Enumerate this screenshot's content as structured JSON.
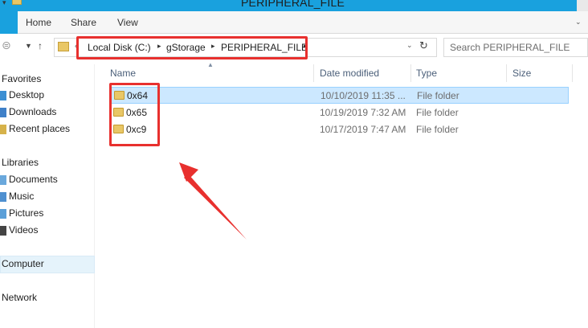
{
  "window": {
    "title": "PERIPHERAL_FILE"
  },
  "ribbon": {
    "tabs": [
      "Home",
      "Share",
      "View"
    ]
  },
  "address": {
    "breadcrumbs": [
      "Local Disk (C:)",
      "gStorage",
      "PERIPHERAL_FILE"
    ]
  },
  "search": {
    "placeholder": "Search PERIPHERAL_FILE"
  },
  "nav_pane": {
    "favorites_header": "Favorites",
    "favorites": [
      "Desktop",
      "Downloads",
      "Recent places"
    ],
    "libraries_header": "Libraries",
    "libraries": [
      "Documents",
      "Music",
      "Pictures",
      "Videos"
    ],
    "computer": "Computer",
    "network": "Network"
  },
  "columns": {
    "name": "Name",
    "date_modified": "Date modified",
    "type": "Type",
    "size": "Size"
  },
  "files": [
    {
      "name": "0x64",
      "date_modified": "10/10/2019 11:35 ...",
      "type": "File folder",
      "selected": true
    },
    {
      "name": "0x65",
      "date_modified": "10/19/2019 7:32 AM",
      "type": "File folder",
      "selected": false
    },
    {
      "name": "0xc9",
      "date_modified": "10/17/2019 7:47 AM",
      "type": "File folder",
      "selected": false
    }
  ],
  "colors": {
    "accent": "#19a1de",
    "annotation": "#e8302e",
    "selection": "#cce8ff"
  }
}
